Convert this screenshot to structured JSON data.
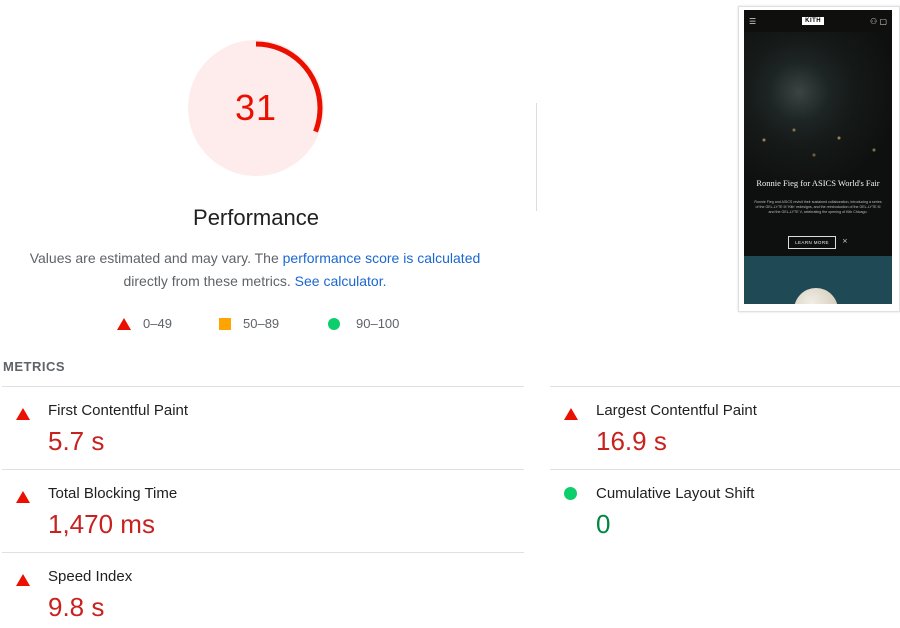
{
  "performance": {
    "score": "31",
    "score_fraction": 0.31,
    "title": "Performance",
    "score_color": "#eb0f00",
    "gauge_bg": "#fdeceb"
  },
  "description": {
    "text_1": "Values are estimated and may vary. The",
    "link_1": "performance score is calculated",
    "text_2": "directly from these metrics.",
    "link_2": "See calculator."
  },
  "legend": [
    {
      "icon": "triangle-red",
      "range": "0–49"
    },
    {
      "icon": "square-orange",
      "range": "50–89"
    },
    {
      "icon": "circle-green",
      "range": "90–100"
    }
  ],
  "thumbnail": {
    "logo": "KITH",
    "menu_icon": "hamburger-icon",
    "headline": "Ronnie Fieg for ASICS World's Fair",
    "body": "Ronnie Fieg and ASICS revisit their sustained collaboration, introducing a series of the GEL-LYTE III 'Kith' redesigns, and the reintroduction of the GEL-LYTE III and the GEL-LYTE V, celebrating the opening of Kith Chicago.",
    "button": "LEARN MORE"
  },
  "metrics": {
    "header": "METRICS",
    "items": [
      {
        "name": "First Contentful Paint",
        "value": "5.7 s",
        "status": "fail"
      },
      {
        "name": "Largest Contentful Paint",
        "value": "16.9 s",
        "status": "fail"
      },
      {
        "name": "Total Blocking Time",
        "value": "1,470 ms",
        "status": "fail"
      },
      {
        "name": "Cumulative Layout Shift",
        "value": "0",
        "status": "pass"
      },
      {
        "name": "Speed Index",
        "value": "9.8 s",
        "status": "fail"
      }
    ]
  }
}
